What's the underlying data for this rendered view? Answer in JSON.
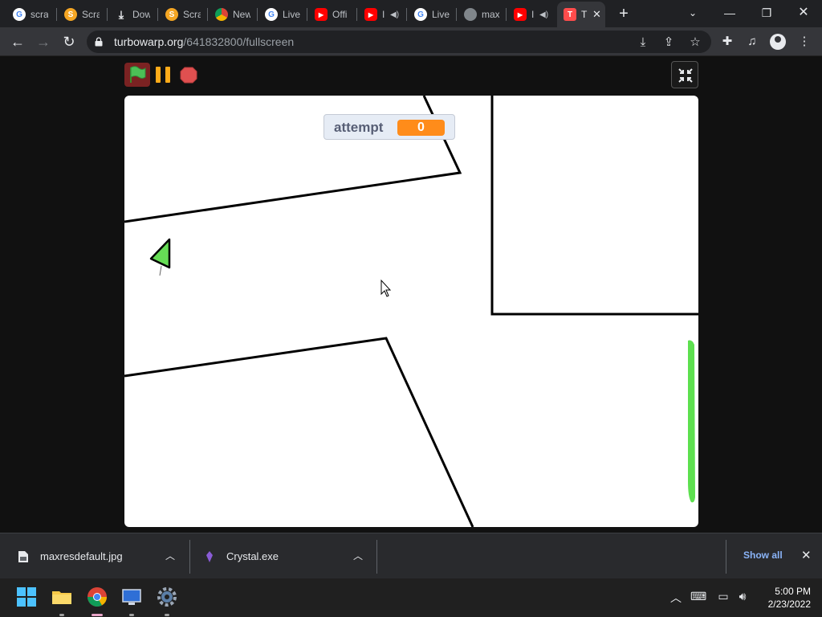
{
  "browser": {
    "tabs": [
      {
        "label": "scra",
        "favicon": "google-icon"
      },
      {
        "label": "Scra",
        "favicon": "scratch-icon"
      },
      {
        "label": "Dow",
        "favicon": "download-icon"
      },
      {
        "label": "Scra",
        "favicon": "scratch-icon"
      },
      {
        "label": "New",
        "favicon": "chrome-icon"
      },
      {
        "label": "Live",
        "favicon": "google-icon"
      },
      {
        "label": "Offi",
        "favicon": "youtube-icon"
      },
      {
        "label": "I",
        "favicon": "youtube-icon",
        "audio": true
      },
      {
        "label": "Live",
        "favicon": "google-icon"
      },
      {
        "label": "max",
        "favicon": "globe-icon"
      },
      {
        "label": "I",
        "favicon": "youtube-icon",
        "audio": true
      },
      {
        "label": "T",
        "favicon": "turbowarp-icon",
        "active": true
      }
    ],
    "url_host": "turbowarp.org",
    "url_path": "/641832800/fullscreen"
  },
  "stage": {
    "monitor_label": "attempt",
    "monitor_value": "0"
  },
  "downloads": {
    "items": [
      {
        "name": "maxresdefault.jpg",
        "icon": "image-file-icon"
      },
      {
        "name": "Crystal.exe",
        "icon": "crystal-exe-icon"
      }
    ],
    "show_all": "Show all"
  },
  "taskbar": {
    "time": "5:00 PM",
    "date": "2/23/2022"
  },
  "colors": {
    "monitor_value_bg": "#ff8c1a",
    "player_arrow": "#66dd55",
    "goal_bar": "#5de04f",
    "stop": "#e05050",
    "pause": "#ffab19"
  }
}
